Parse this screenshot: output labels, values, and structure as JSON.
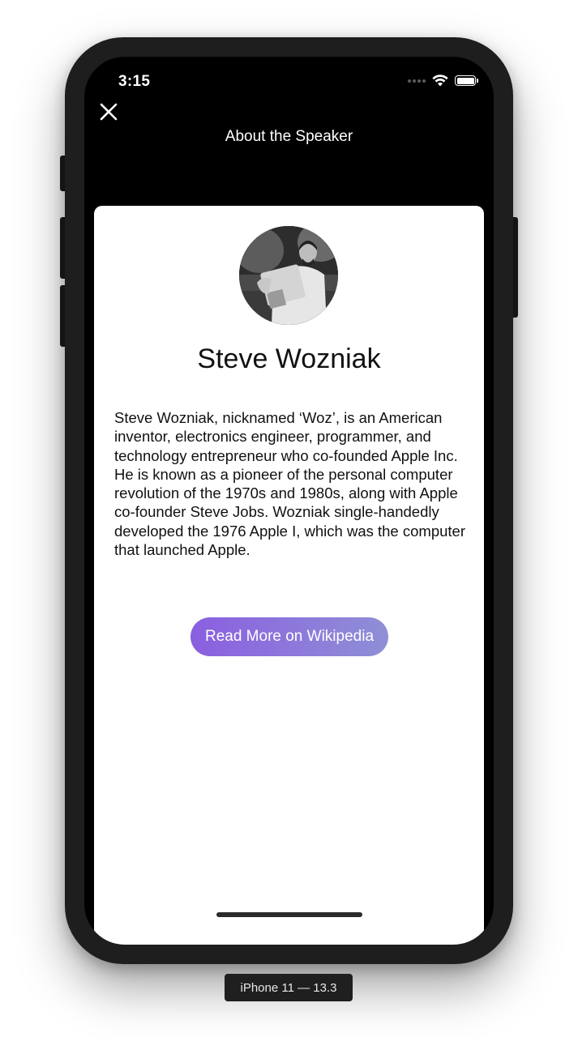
{
  "status_bar": {
    "time": "3:15",
    "icons": [
      "cellular-signal-icon",
      "wifi-icon",
      "battery-icon"
    ]
  },
  "nav": {
    "close_icon": "close-icon",
    "title": "About the Speaker"
  },
  "speaker": {
    "avatar_icon": "speaker-avatar",
    "name": "Steve Wozniak",
    "bio": "Steve Wozniak, nicknamed ‘Woz’, is an American inventor, electronics engineer, programmer, and technology entrepreneur who co-founded Apple Inc. He is known as a pioneer of the personal computer revolution of the 1970s and 1980s, along with Apple co-founder Steve Jobs. Wozniak single-handedly developed the 1976 Apple I, which was the computer that launched Apple."
  },
  "actions": {
    "wiki_button_label": "Read More on Wikipedia"
  },
  "simulator": {
    "device_label": "iPhone 11 — 13.3"
  },
  "colors": {
    "button_gradient_start": "#8a5fe0",
    "button_gradient_end": "#8f8fd6",
    "nav_background": "#000000",
    "sheet_background": "#ffffff"
  }
}
